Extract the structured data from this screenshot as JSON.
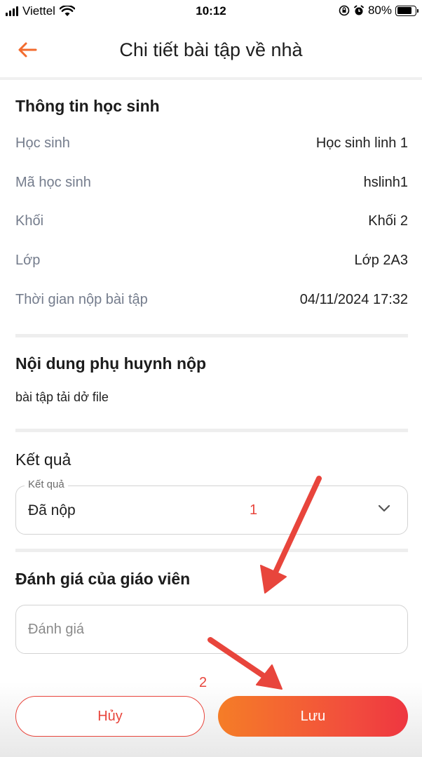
{
  "status_bar": {
    "carrier": "Viettel",
    "time": "10:12",
    "battery_percent": "80%",
    "battery_level": 0.8,
    "icons": [
      "signal-icon",
      "wifi-icon",
      "orientation-lock-icon",
      "alarm-icon",
      "battery-icon"
    ]
  },
  "header": {
    "title": "Chi tiết bài tập về nhà",
    "back_icon": "back-arrow-icon",
    "accent_color": "#f26b2e"
  },
  "student_info": {
    "title": "Thông tin học sinh",
    "rows": [
      {
        "label": "Học sinh",
        "value": "Học sinh linh 1"
      },
      {
        "label": "Mã học sinh",
        "value": "hslinh1"
      },
      {
        "label": "Khối",
        "value": "Khối 2"
      },
      {
        "label": "Lớp",
        "value": "Lớp 2A3"
      },
      {
        "label": "Thời gian nộp bài tập",
        "value": "04/11/2024 17:32"
      }
    ]
  },
  "parent_submission": {
    "title": "Nội dung phụ huynh nộp",
    "content": "bài tập tải dở file"
  },
  "result": {
    "title": "Kết quả",
    "field_label": "Kết quả",
    "selected_value": "Đã nộp",
    "chevron_icon": "chevron-down-icon"
  },
  "teacher_review": {
    "title": "Đánh giá của giáo viên",
    "placeholder": "Đánh giá",
    "value": ""
  },
  "actions": {
    "cancel_label": "Hủy",
    "save_label": "Lưu"
  },
  "annotations": {
    "marker_1": "1",
    "marker_2": "2",
    "color": "#e8453c"
  }
}
